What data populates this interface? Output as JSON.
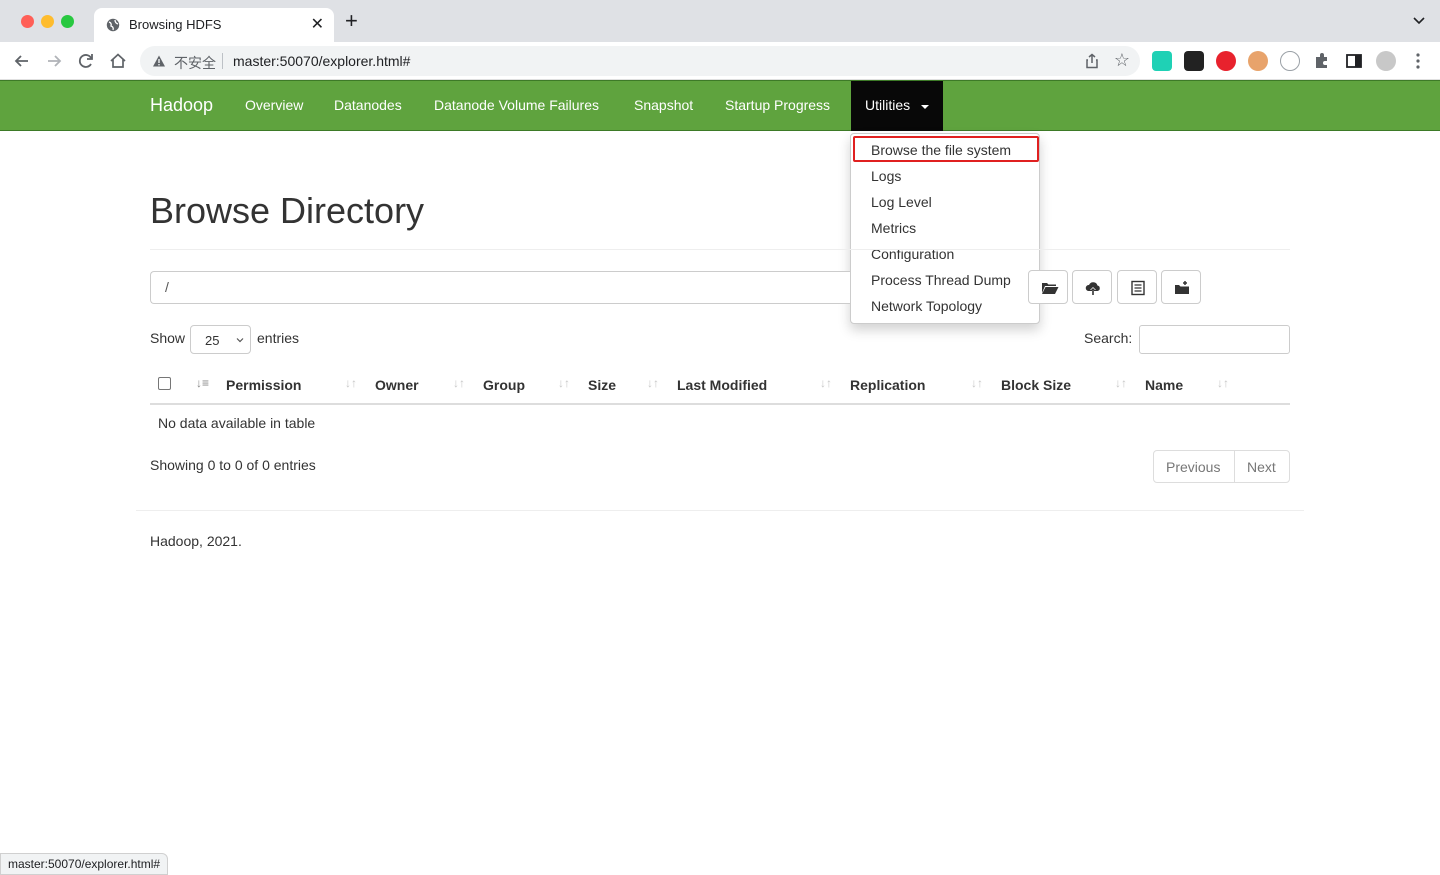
{
  "browser": {
    "tab_title": "Browsing HDFS",
    "security_label": "不安全",
    "url": "master:50070/explorer.html#",
    "status_url": "master:50070/explorer.html#"
  },
  "navbar": {
    "brand": "Hadoop",
    "items": [
      {
        "label": "Overview"
      },
      {
        "label": "Datanodes"
      },
      {
        "label": "Datanode Volume Failures"
      },
      {
        "label": "Snapshot"
      },
      {
        "label": "Startup Progress"
      }
    ],
    "active": "Utilities"
  },
  "dropdown": {
    "items": [
      {
        "label": "Browse the file system"
      },
      {
        "label": "Logs"
      },
      {
        "label": "Log Level"
      },
      {
        "label": "Metrics"
      },
      {
        "label": "Configuration"
      },
      {
        "label": "Process Thread Dump"
      },
      {
        "label": "Network Topology"
      }
    ]
  },
  "main": {
    "title": "Browse Directory",
    "path_value": "/",
    "show_label": "Show",
    "entries_value": "25",
    "entries_label": "entries",
    "search_label": "Search:",
    "columns": [
      "Permission",
      "Owner",
      "Group",
      "Size",
      "Last Modified",
      "Replication",
      "Block Size",
      "Name"
    ],
    "empty_message": "No data available in table",
    "info": "Showing 0 to 0 of 0 entries",
    "prev_label": "Previous",
    "next_label": "Next",
    "footer": "Hadoop, 2021."
  },
  "colors": {
    "navbar": "#5fa33e",
    "navbar_active": "#080808",
    "highlight_border": "#e02020"
  }
}
